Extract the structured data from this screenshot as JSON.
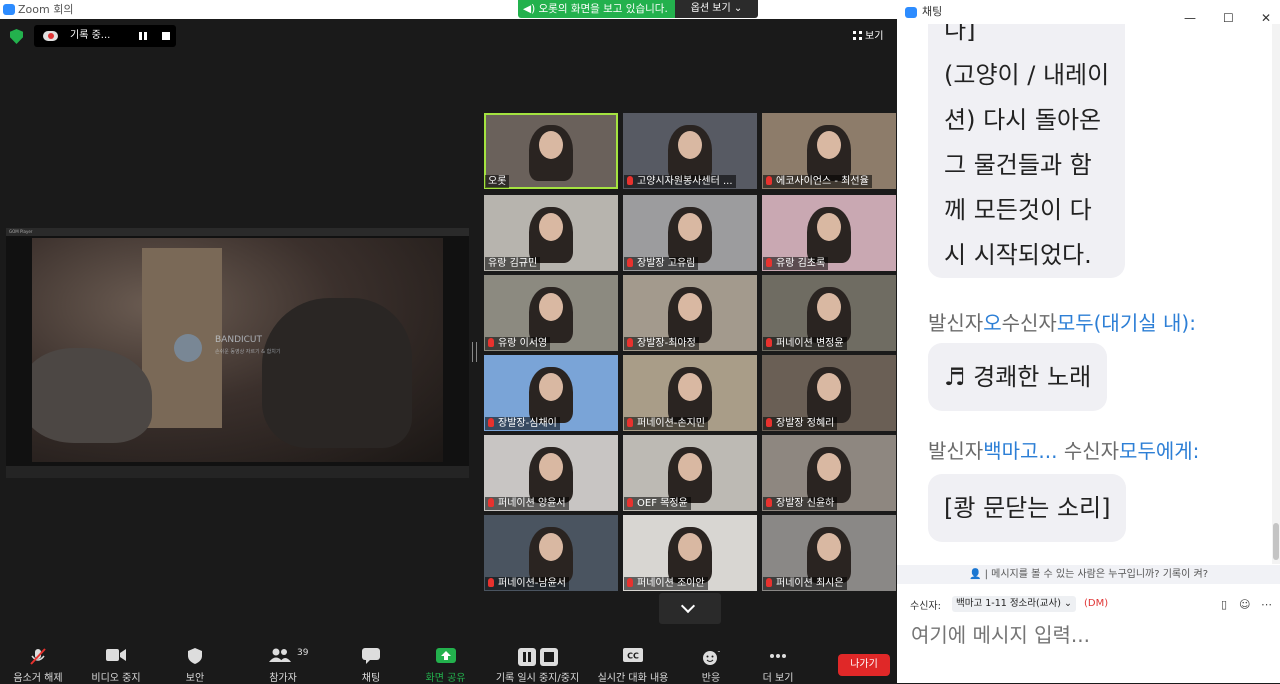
{
  "window": {
    "title": "Zoom 회의"
  },
  "share_banner": {
    "status": "오롯의 화면을 보고 있습니다.",
    "options": "옵션 보기"
  },
  "recording": {
    "label": "기록 중..."
  },
  "view_button": "보기",
  "shared_screen": {
    "player_title": "GOM Player",
    "watermark_title": "BANDICUT",
    "watermark_sub": "손쉬운 동영상 자르기 & 합치기"
  },
  "participants": [
    {
      "name": "오롯",
      "muted": false,
      "active": true
    },
    {
      "name": "고양시자원봉사센터 ...",
      "muted": true
    },
    {
      "name": "에코사이언스 - 최선율",
      "muted": true
    },
    {
      "name": "유랑 김규민",
      "muted": false
    },
    {
      "name": "장발장 고유림",
      "muted": true
    },
    {
      "name": "유랑 김초록",
      "muted": true
    },
    {
      "name": "유랑 이서영",
      "muted": true
    },
    {
      "name": "장발장-최아정",
      "muted": true
    },
    {
      "name": "퍼네이션 변정윤",
      "muted": true
    },
    {
      "name": "장발장-심채이",
      "muted": true
    },
    {
      "name": "퍼네이션-손지민",
      "muted": true
    },
    {
      "name": "장발장 정혜리",
      "muted": true
    },
    {
      "name": "퍼네이션 양윤서",
      "muted": true
    },
    {
      "name": "OEF 목정윤",
      "muted": true
    },
    {
      "name": "장발장 신윤하",
      "muted": true
    },
    {
      "name": "퍼네이션-남윤서",
      "muted": true
    },
    {
      "name": "퍼네이션 조이안",
      "muted": true
    },
    {
      "name": "퍼네이션 최시은",
      "muted": true
    }
  ],
  "toolbar": {
    "unmute": "음소거 해제",
    "stop_video": "비디오 중지",
    "security": "보안",
    "participants": "참가자",
    "participant_count": "39",
    "chat": "채팅",
    "share_screen": "화면 공유",
    "pause_stop_recording": "기록 일시 중지/중지",
    "live_transcript": "실시간 대화 내용",
    "reactions": "반응",
    "more": "더 보기",
    "leave": "나가기"
  },
  "chat": {
    "title": "채팅",
    "bubble1_lines": [
      "다]",
      "(고양이 / 내레이",
      "션) 다시 돌아온",
      "그 물건들과 함",
      "께 모든것이 다",
      "시 시작되었다."
    ],
    "msg2": {
      "prefix": "발신자",
      "from": "오",
      "mid": "수신자",
      "to": "모두(대기실 내)",
      "suffix": ":",
      "text": "♬ 경쾌한 노래"
    },
    "msg3": {
      "prefix": "발신자",
      "from": "백마고...",
      "mid": " 수신자",
      "to": "모두에게",
      "suffix": ":",
      "text": "[쾅 문닫는 소리]"
    },
    "who_can_see": "| 메시지를 볼 수 있는 사람은 누구입니까? 기록이 켜?",
    "to_label": "수신자:",
    "to_value": "백마고 1-11 정소라(교사)",
    "dm": "(DM)",
    "input_placeholder": "여기에 메시지 입력..."
  },
  "colors": {
    "accent_green": "#23b14d",
    "active_speaker": "#a4e340",
    "leave_red": "#e02828",
    "chat_link_blue": "#2d7fd6"
  }
}
